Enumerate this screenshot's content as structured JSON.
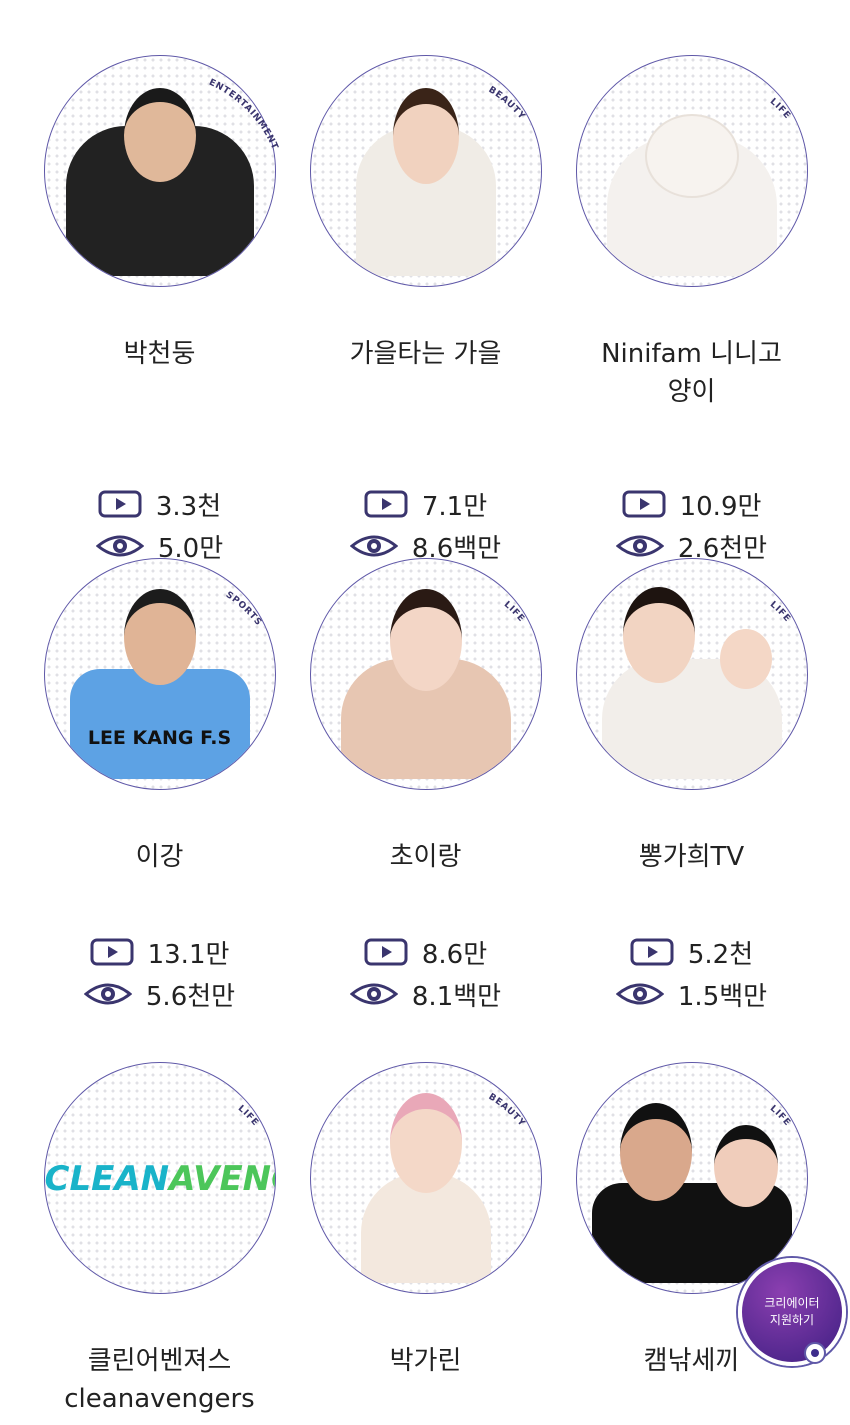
{
  "colors": {
    "accent": "#5f58a8",
    "category_text": "#3a356e",
    "text": "#222222"
  },
  "creators": [
    {
      "name": "박천둥",
      "category": "ENTERTAINMENT",
      "videos": "3.3천",
      "views": "5.0만",
      "avatar": "man-black-jacket"
    },
    {
      "name": "가을타는 가을",
      "category": "BEAUTY",
      "videos": "7.1만",
      "views": "8.6백만",
      "avatar": "woman-white-top"
    },
    {
      "name": "Ninifam 니니고양이",
      "category": "LIFE",
      "videos": "10.9만",
      "views": "2.6천만",
      "avatar": "white-kitten"
    },
    {
      "name": "이강",
      "category": "SPORTS",
      "videos": "13.1만",
      "views": "5.6천만",
      "avatar": "man-blue-jersey"
    },
    {
      "name": "초이랑",
      "category": "LIFE",
      "videos": "8.6만",
      "views": "8.1백만",
      "avatar": "woman-beige-jacket"
    },
    {
      "name": "뽕가희TV",
      "category": "LIFE",
      "videos": "5.2천",
      "views": "1.5백만",
      "avatar": "woman-with-baby"
    },
    {
      "name": "클린어벤져스 cleanavengers",
      "category": "LIFE",
      "logo": "CLEANAVENGERS",
      "avatar": "logo"
    },
    {
      "name": "박가린",
      "category": "BEAUTY",
      "avatar": "woman-flower-crown"
    },
    {
      "name": "캠낚세끼",
      "category": "LIFE",
      "avatar": "couple-caps"
    }
  ],
  "jersey_text": "LEE KANG F.S",
  "logo_part1": "CLEAN",
  "logo_part2": "AVENGERS",
  "floating_button": {
    "line1": "크리에이터",
    "line2": "지원하기"
  },
  "icons": {
    "video": "play-icon",
    "views": "eye-icon"
  }
}
